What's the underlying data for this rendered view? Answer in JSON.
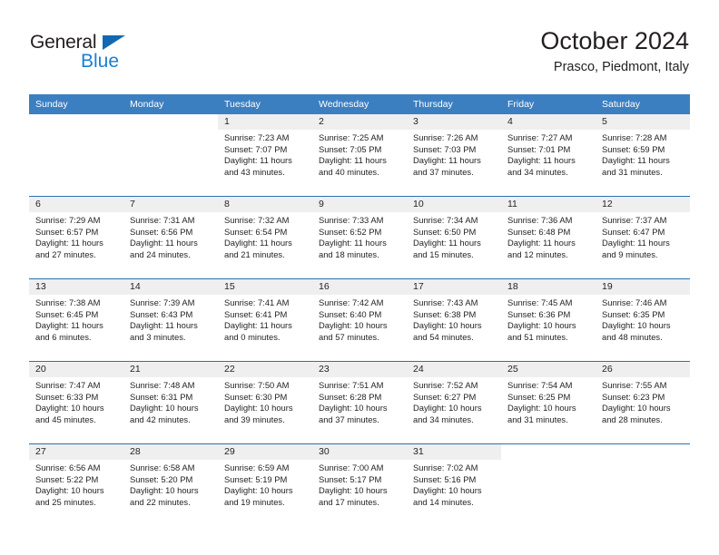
{
  "brand": {
    "line1": "General",
    "line2": "Blue",
    "triangle_color": "#1268b3",
    "blue_color": "#1a7fd4"
  },
  "header": {
    "title": "October 2024",
    "subtitle": "Prasco, Piedmont, Italy"
  },
  "theme": {
    "header_bg": "#3c7fc1",
    "row_divider": "#2f6fad",
    "daynum_bg": "#efefef",
    "text": "#231f20"
  },
  "calendar": {
    "weekday_headers": [
      "Sunday",
      "Monday",
      "Tuesday",
      "Wednesday",
      "Thursday",
      "Friday",
      "Saturday"
    ],
    "labels": {
      "sunrise": "Sunrise:",
      "sunset": "Sunset:",
      "daylight": "Daylight:"
    },
    "weeks": [
      [
        {
          "day": "",
          "sunrise": "",
          "sunset": "",
          "daylight": ""
        },
        {
          "day": "",
          "sunrise": "",
          "sunset": "",
          "daylight": ""
        },
        {
          "day": "1",
          "sunrise": "Sunrise: 7:23 AM",
          "sunset": "Sunset: 7:07 PM",
          "daylight": "Daylight: 11 hours and 43 minutes."
        },
        {
          "day": "2",
          "sunrise": "Sunrise: 7:25 AM",
          "sunset": "Sunset: 7:05 PM",
          "daylight": "Daylight: 11 hours and 40 minutes."
        },
        {
          "day": "3",
          "sunrise": "Sunrise: 7:26 AM",
          "sunset": "Sunset: 7:03 PM",
          "daylight": "Daylight: 11 hours and 37 minutes."
        },
        {
          "day": "4",
          "sunrise": "Sunrise: 7:27 AM",
          "sunset": "Sunset: 7:01 PM",
          "daylight": "Daylight: 11 hours and 34 minutes."
        },
        {
          "day": "5",
          "sunrise": "Sunrise: 7:28 AM",
          "sunset": "Sunset: 6:59 PM",
          "daylight": "Daylight: 11 hours and 31 minutes."
        }
      ],
      [
        {
          "day": "6",
          "sunrise": "Sunrise: 7:29 AM",
          "sunset": "Sunset: 6:57 PM",
          "daylight": "Daylight: 11 hours and 27 minutes."
        },
        {
          "day": "7",
          "sunrise": "Sunrise: 7:31 AM",
          "sunset": "Sunset: 6:56 PM",
          "daylight": "Daylight: 11 hours and 24 minutes."
        },
        {
          "day": "8",
          "sunrise": "Sunrise: 7:32 AM",
          "sunset": "Sunset: 6:54 PM",
          "daylight": "Daylight: 11 hours and 21 minutes."
        },
        {
          "day": "9",
          "sunrise": "Sunrise: 7:33 AM",
          "sunset": "Sunset: 6:52 PM",
          "daylight": "Daylight: 11 hours and 18 minutes."
        },
        {
          "day": "10",
          "sunrise": "Sunrise: 7:34 AM",
          "sunset": "Sunset: 6:50 PM",
          "daylight": "Daylight: 11 hours and 15 minutes."
        },
        {
          "day": "11",
          "sunrise": "Sunrise: 7:36 AM",
          "sunset": "Sunset: 6:48 PM",
          "daylight": "Daylight: 11 hours and 12 minutes."
        },
        {
          "day": "12",
          "sunrise": "Sunrise: 7:37 AM",
          "sunset": "Sunset: 6:47 PM",
          "daylight": "Daylight: 11 hours and 9 minutes."
        }
      ],
      [
        {
          "day": "13",
          "sunrise": "Sunrise: 7:38 AM",
          "sunset": "Sunset: 6:45 PM",
          "daylight": "Daylight: 11 hours and 6 minutes."
        },
        {
          "day": "14",
          "sunrise": "Sunrise: 7:39 AM",
          "sunset": "Sunset: 6:43 PM",
          "daylight": "Daylight: 11 hours and 3 minutes."
        },
        {
          "day": "15",
          "sunrise": "Sunrise: 7:41 AM",
          "sunset": "Sunset: 6:41 PM",
          "daylight": "Daylight: 11 hours and 0 minutes."
        },
        {
          "day": "16",
          "sunrise": "Sunrise: 7:42 AM",
          "sunset": "Sunset: 6:40 PM",
          "daylight": "Daylight: 10 hours and 57 minutes."
        },
        {
          "day": "17",
          "sunrise": "Sunrise: 7:43 AM",
          "sunset": "Sunset: 6:38 PM",
          "daylight": "Daylight: 10 hours and 54 minutes."
        },
        {
          "day": "18",
          "sunrise": "Sunrise: 7:45 AM",
          "sunset": "Sunset: 6:36 PM",
          "daylight": "Daylight: 10 hours and 51 minutes."
        },
        {
          "day": "19",
          "sunrise": "Sunrise: 7:46 AM",
          "sunset": "Sunset: 6:35 PM",
          "daylight": "Daylight: 10 hours and 48 minutes."
        }
      ],
      [
        {
          "day": "20",
          "sunrise": "Sunrise: 7:47 AM",
          "sunset": "Sunset: 6:33 PM",
          "daylight": "Daylight: 10 hours and 45 minutes."
        },
        {
          "day": "21",
          "sunrise": "Sunrise: 7:48 AM",
          "sunset": "Sunset: 6:31 PM",
          "daylight": "Daylight: 10 hours and 42 minutes."
        },
        {
          "day": "22",
          "sunrise": "Sunrise: 7:50 AM",
          "sunset": "Sunset: 6:30 PM",
          "daylight": "Daylight: 10 hours and 39 minutes."
        },
        {
          "day": "23",
          "sunrise": "Sunrise: 7:51 AM",
          "sunset": "Sunset: 6:28 PM",
          "daylight": "Daylight: 10 hours and 37 minutes."
        },
        {
          "day": "24",
          "sunrise": "Sunrise: 7:52 AM",
          "sunset": "Sunset: 6:27 PM",
          "daylight": "Daylight: 10 hours and 34 minutes."
        },
        {
          "day": "25",
          "sunrise": "Sunrise: 7:54 AM",
          "sunset": "Sunset: 6:25 PM",
          "daylight": "Daylight: 10 hours and 31 minutes."
        },
        {
          "day": "26",
          "sunrise": "Sunrise: 7:55 AM",
          "sunset": "Sunset: 6:23 PM",
          "daylight": "Daylight: 10 hours and 28 minutes."
        }
      ],
      [
        {
          "day": "27",
          "sunrise": "Sunrise: 6:56 AM",
          "sunset": "Sunset: 5:22 PM",
          "daylight": "Daylight: 10 hours and 25 minutes."
        },
        {
          "day": "28",
          "sunrise": "Sunrise: 6:58 AM",
          "sunset": "Sunset: 5:20 PM",
          "daylight": "Daylight: 10 hours and 22 minutes."
        },
        {
          "day": "29",
          "sunrise": "Sunrise: 6:59 AM",
          "sunset": "Sunset: 5:19 PM",
          "daylight": "Daylight: 10 hours and 19 minutes."
        },
        {
          "day": "30",
          "sunrise": "Sunrise: 7:00 AM",
          "sunset": "Sunset: 5:17 PM",
          "daylight": "Daylight: 10 hours and 17 minutes."
        },
        {
          "day": "31",
          "sunrise": "Sunrise: 7:02 AM",
          "sunset": "Sunset: 5:16 PM",
          "daylight": "Daylight: 10 hours and 14 minutes."
        },
        {
          "day": "",
          "sunrise": "",
          "sunset": "",
          "daylight": ""
        },
        {
          "day": "",
          "sunrise": "",
          "sunset": "",
          "daylight": ""
        }
      ]
    ]
  }
}
